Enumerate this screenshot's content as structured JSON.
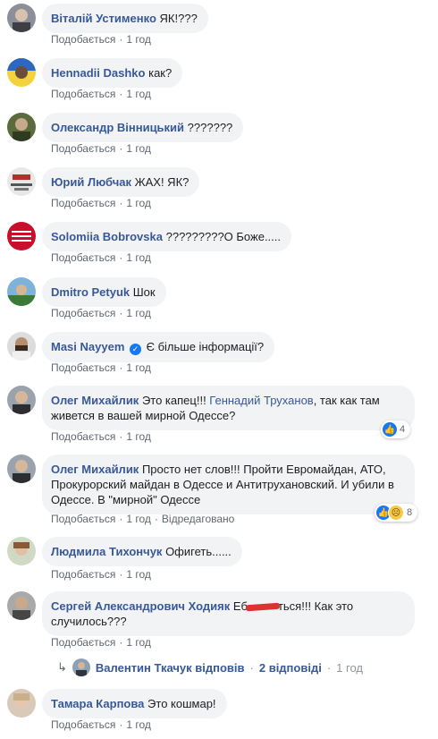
{
  "like_label": "Подобається",
  "time_label": "1 год",
  "edited_label": "Відредаговано",
  "comments": [
    {
      "author": "Віталій Устименко",
      "text": "ЯК!???"
    },
    {
      "author": "Hennadii Dashko",
      "text": "как?"
    },
    {
      "author": "Олександр Вінницький",
      "text": "???????"
    },
    {
      "author": "Юрий Любчак",
      "text": "ЖАХ! ЯК?"
    },
    {
      "author": "Solomiia Bobrovska",
      "text": "?????????О Боже....."
    },
    {
      "author": "Dmitro Petyuk",
      "text": "Шок"
    },
    {
      "author": "Masi Nayyem",
      "text": "Є більше інформації?"
    },
    {
      "author": "Олег Михайлик",
      "text_before": "Это капец!!! ",
      "mention": "Геннадий Труханов",
      "text_after": ", так как там живется в вашей мирной Одессе?",
      "reaction_count": "4"
    },
    {
      "author": "Олег Михайлик",
      "text": "Просто нет слов!!! Пройти Евромайдан, АТО, Прокурорский майдан в Одессе и Антитрухановский. И убили в Одессе. В \"мирной\" Одессе",
      "reaction_count": "8"
    },
    {
      "author": "Людмила Тихончук",
      "text": "Офигеть......"
    },
    {
      "author": "Сергей Александрович Ходияк",
      "text_before": "Еб",
      "text_after": "ться!!! Как это случилось???"
    },
    {
      "author": "Тамара Карпова",
      "text": "Это кошмар!"
    }
  ],
  "replies": {
    "author": "Валентин Ткачук відповів",
    "count": "2 відповіді",
    "time": "1 год"
  },
  "colors": {
    "link": "#385898",
    "bubble": "#f2f3f5",
    "meta": "#606770",
    "like_reaction": "#1877f2"
  }
}
